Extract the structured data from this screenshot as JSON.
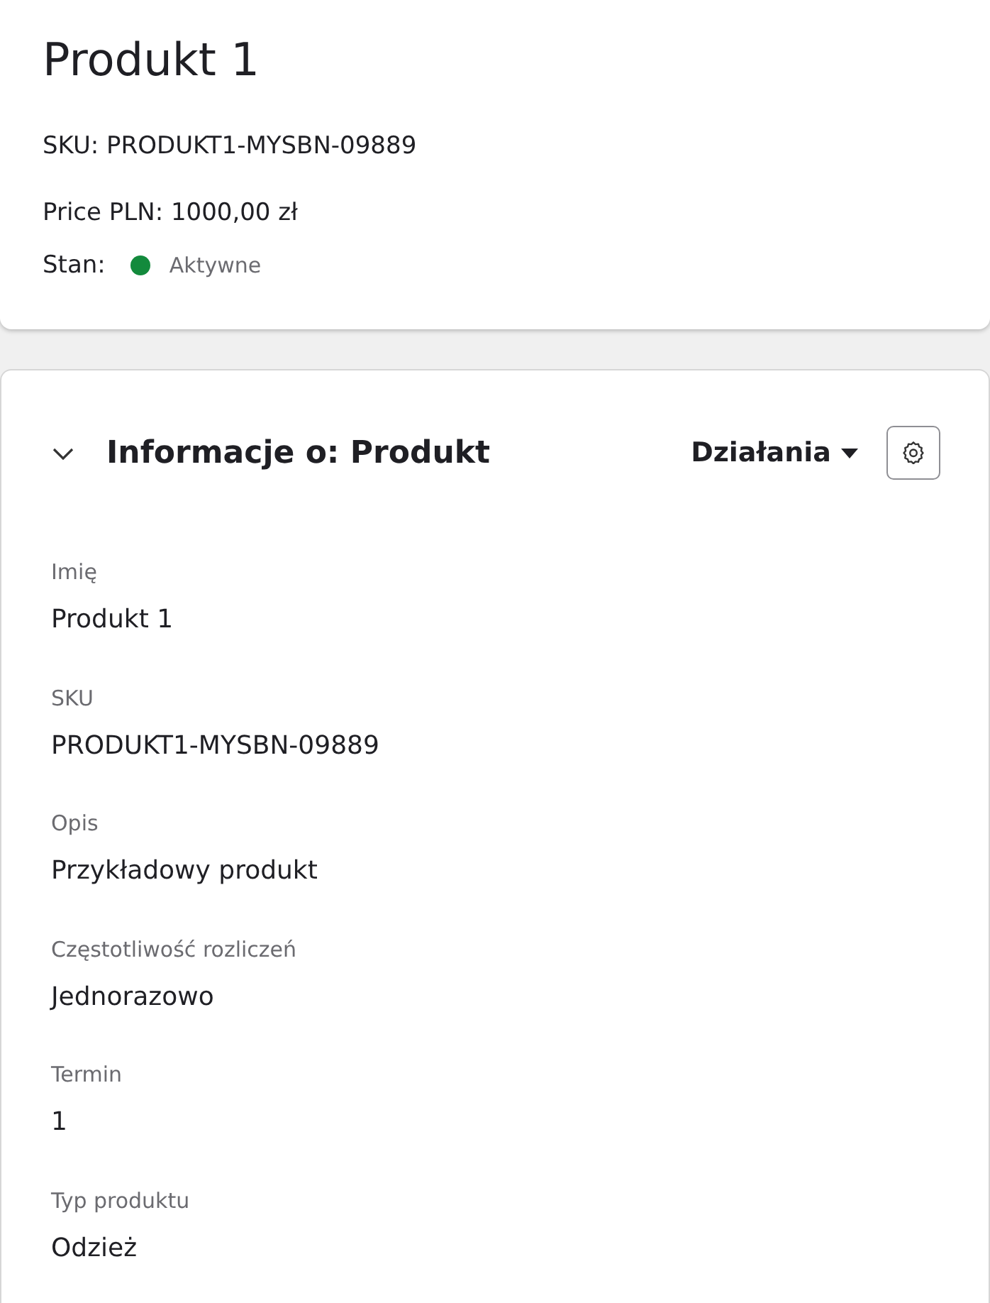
{
  "header": {
    "title": "Produkt 1",
    "lines": [
      "SKU: PRODUKT1-MYSBN-09889",
      "Price PLN: 1000,00 zł"
    ],
    "status": {
      "label": "Stan:",
      "value": "Aktywne",
      "color": "#138a3c"
    }
  },
  "section": {
    "title": "Informacje o: Produkt",
    "expanded": true,
    "actions_label": "Działania",
    "fields": [
      {
        "label": "Imię",
        "value": "Produkt 1"
      },
      {
        "label": "SKU",
        "value": "PRODUKT1-MYSBN-09889"
      },
      {
        "label": "Opis",
        "value": "Przykładowy produkt"
      },
      {
        "label": "Częstotliwość rozliczeń",
        "value": "Jednorazowo"
      },
      {
        "label": "Termin",
        "value": "1"
      },
      {
        "label": "Typ produktu",
        "value": "Odzież"
      }
    ]
  }
}
